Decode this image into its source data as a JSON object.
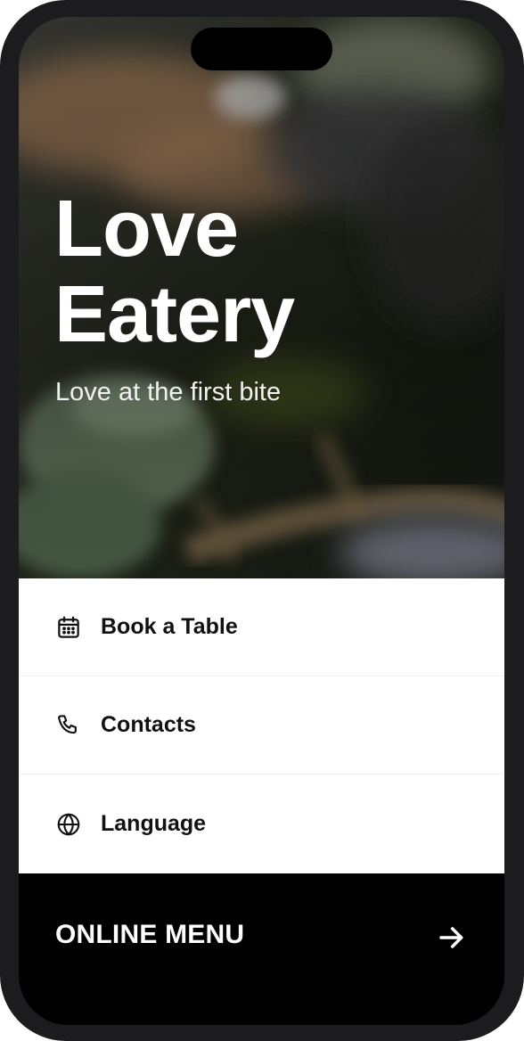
{
  "hero": {
    "title": "Love\nEatery",
    "subtitle": "Love at the first bite"
  },
  "menu": {
    "items": [
      {
        "label": "Book a Table",
        "icon": "calendar-icon"
      },
      {
        "label": "Contacts",
        "icon": "phone-icon"
      },
      {
        "label": "Language",
        "icon": "globe-icon"
      }
    ]
  },
  "cta": {
    "label": "ONLINE MENU",
    "icon": "arrow-right-icon"
  },
  "colors": {
    "frame": "#1c1c1e",
    "text_dark": "#111111",
    "cta_background": "#000000",
    "cta_text": "#ffffff"
  }
}
